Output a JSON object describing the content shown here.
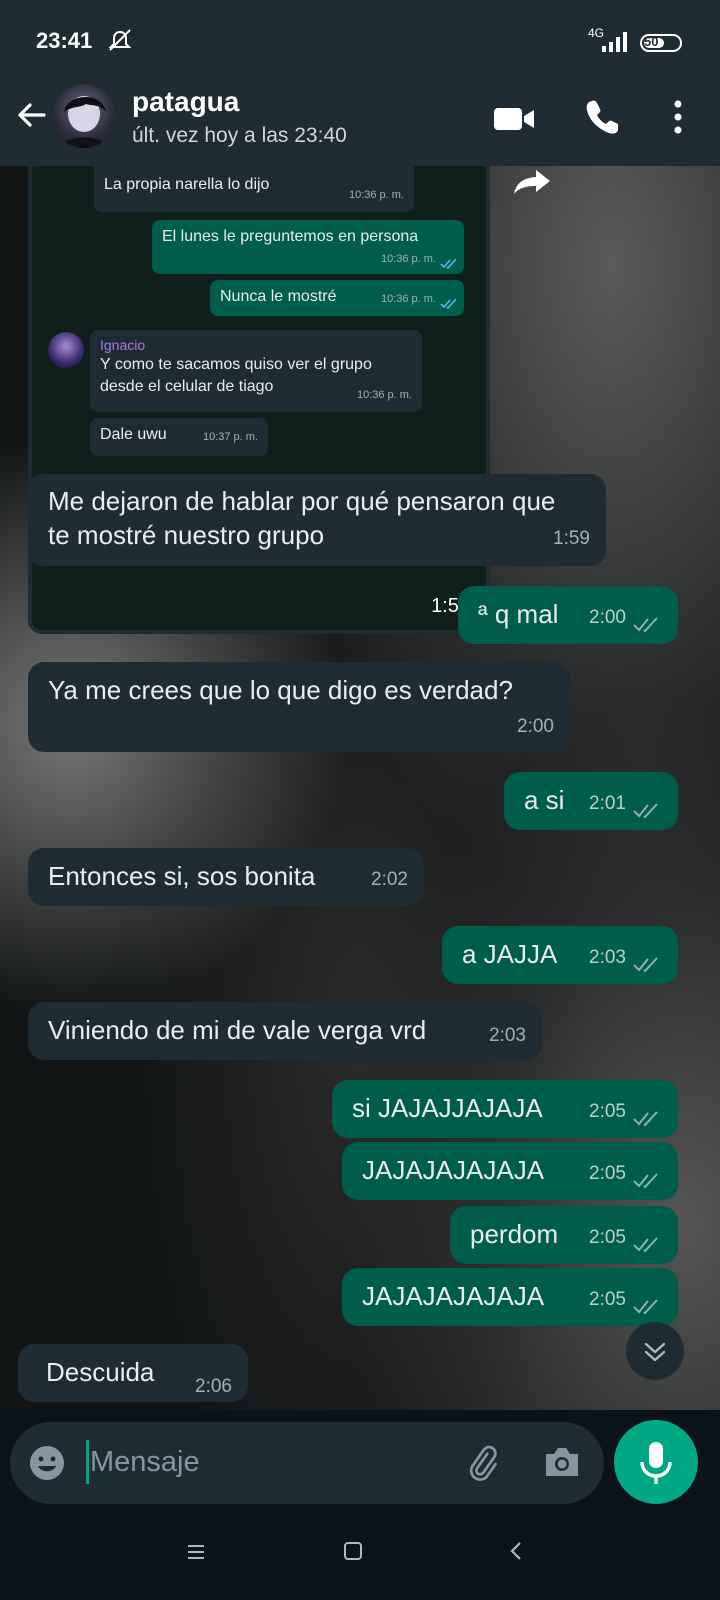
{
  "status_bar": {
    "time": "23:41",
    "network": "4G",
    "battery": "50"
  },
  "header": {
    "contact_name": "patagua",
    "last_seen": "últ. vez hoy a las 23:40"
  },
  "quoted_screenshot": {
    "timestamp": "1:58",
    "messages": [
      {
        "dir": "in",
        "text": "La propia narella lo dijo",
        "time": "10:36 p. m."
      },
      {
        "dir": "out",
        "text": "El lunes le preguntemos en persona",
        "time": "10:36 p. m."
      },
      {
        "dir": "out",
        "text": "Nunca le mostré",
        "time": "10:36 p. m."
      },
      {
        "dir": "in",
        "sender": "Ignacio",
        "text": "Y como te sacamos quiso ver el grupo desde el celular de tiago",
        "time": "10:36 p. m."
      },
      {
        "dir": "in",
        "text": "Dale uwu",
        "time": "10:37 p. m."
      }
    ]
  },
  "messages": [
    {
      "dir": "in",
      "text": "Me dejaron de hablar por qué pensaron que te mostré nuestro grupo",
      "time": "1:59"
    },
    {
      "dir": "out",
      "text": "ª q mal",
      "time": "2:00"
    },
    {
      "dir": "in",
      "text": "Ya me crees que lo que digo es verdad?",
      "time": "2:00"
    },
    {
      "dir": "out",
      "text": "a si",
      "time": "2:01"
    },
    {
      "dir": "in",
      "text": "Entonces si, sos bonita",
      "time": "2:02"
    },
    {
      "dir": "out",
      "text": "a JAJJA",
      "time": "2:03"
    },
    {
      "dir": "in",
      "text": "Viniendo de mi de vale verga vrd",
      "time": "2:03"
    },
    {
      "dir": "out",
      "text": "si JAJAJJAJAJA",
      "time": "2:05"
    },
    {
      "dir": "out",
      "text": "JAJAJAJAJAJA",
      "time": "2:05"
    },
    {
      "dir": "out",
      "text": "perdom",
      "time": "2:05"
    },
    {
      "dir": "out",
      "text": "JAJAJAJAJAJA",
      "time": "2:05"
    },
    {
      "dir": "in",
      "text": "Descuida",
      "time": "2:06"
    }
  ],
  "input": {
    "placeholder": "Mensaje"
  },
  "colors": {
    "header_bg": "#1f2c34",
    "incoming": "#1f2c34",
    "outgoing": "#005c4b",
    "accent": "#00a884",
    "ticks": "#8fb0b8",
    "ticks_read": "#53bdeb"
  },
  "icons": [
    "back-arrow-icon",
    "video-call-icon",
    "phone-icon",
    "more-vert-icon",
    "forward-icon",
    "scroll-down-icon",
    "emoji-icon",
    "attach-icon",
    "camera-icon",
    "mic-icon",
    "dnd-icon",
    "signal-icon",
    "battery-icon"
  ]
}
